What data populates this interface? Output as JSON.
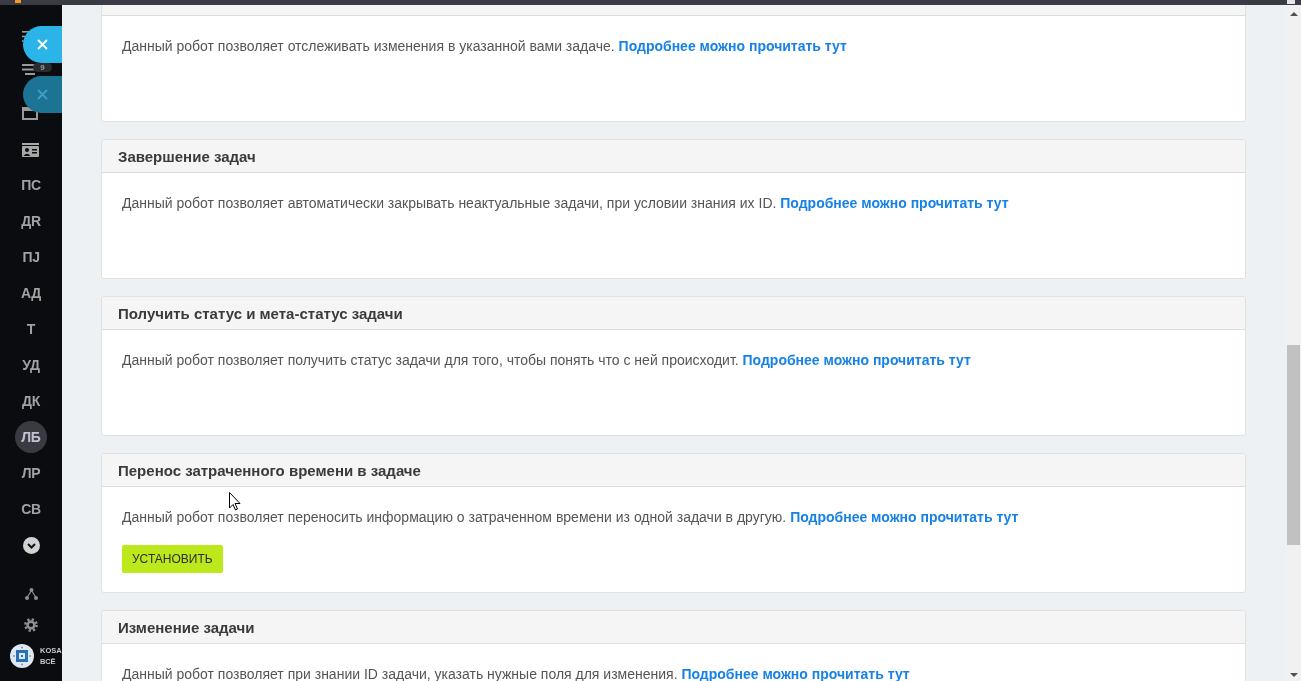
{
  "sidebar": {
    "filter_badge": "9",
    "items": [
      {
        "label": "ПС",
        "selected": false
      },
      {
        "label": "ДR",
        "selected": false
      },
      {
        "label": "ПJ",
        "selected": false
      },
      {
        "label": "АД",
        "selected": false
      },
      {
        "label": "Т",
        "selected": false
      },
      {
        "label": "УД",
        "selected": false
      },
      {
        "label": "ДК",
        "selected": false
      },
      {
        "label": "ЛБ",
        "selected": true
      },
      {
        "label": "ЛР",
        "selected": false
      },
      {
        "label": "СВ",
        "selected": false
      }
    ],
    "logo": {
      "name": "KOSA",
      "tagline": "ВСЁ"
    }
  },
  "floating_buttons": [
    {
      "dimmed": false
    },
    {
      "dimmed": true
    }
  ],
  "robots": [
    {
      "description": "Данный робот позволяет отслеживать изменения в указанной вами задаче.",
      "link": "Подробнее можно прочитать тут"
    },
    {
      "title": "Завершение задач",
      "description": "Данный робот позволяет автоматически закрывать неактуальные задачи, при условии знания их ID.",
      "link": "Подробнее можно прочитать тут"
    },
    {
      "title": "Получить статус и мета-статус задачи",
      "description": "Данный робот позволяет получить статус задачи для того, чтобы понять что с ней происходит.",
      "link": "Подробнее можно прочитать тут"
    },
    {
      "title": "Перенос затраченного времени в задаче",
      "description": "Данный робот позволяет переносить информацию о затраченном времени из одной задачи в другую.",
      "link": "Подробнее можно прочитать тут",
      "button": "УСТАНОВИТЬ"
    },
    {
      "title": "Изменение задачи",
      "description": "Данный робот позволяет при знании ID задачи, указать нужные поля для изменения.",
      "link": "Подробнее можно прочитать тут"
    }
  ]
}
